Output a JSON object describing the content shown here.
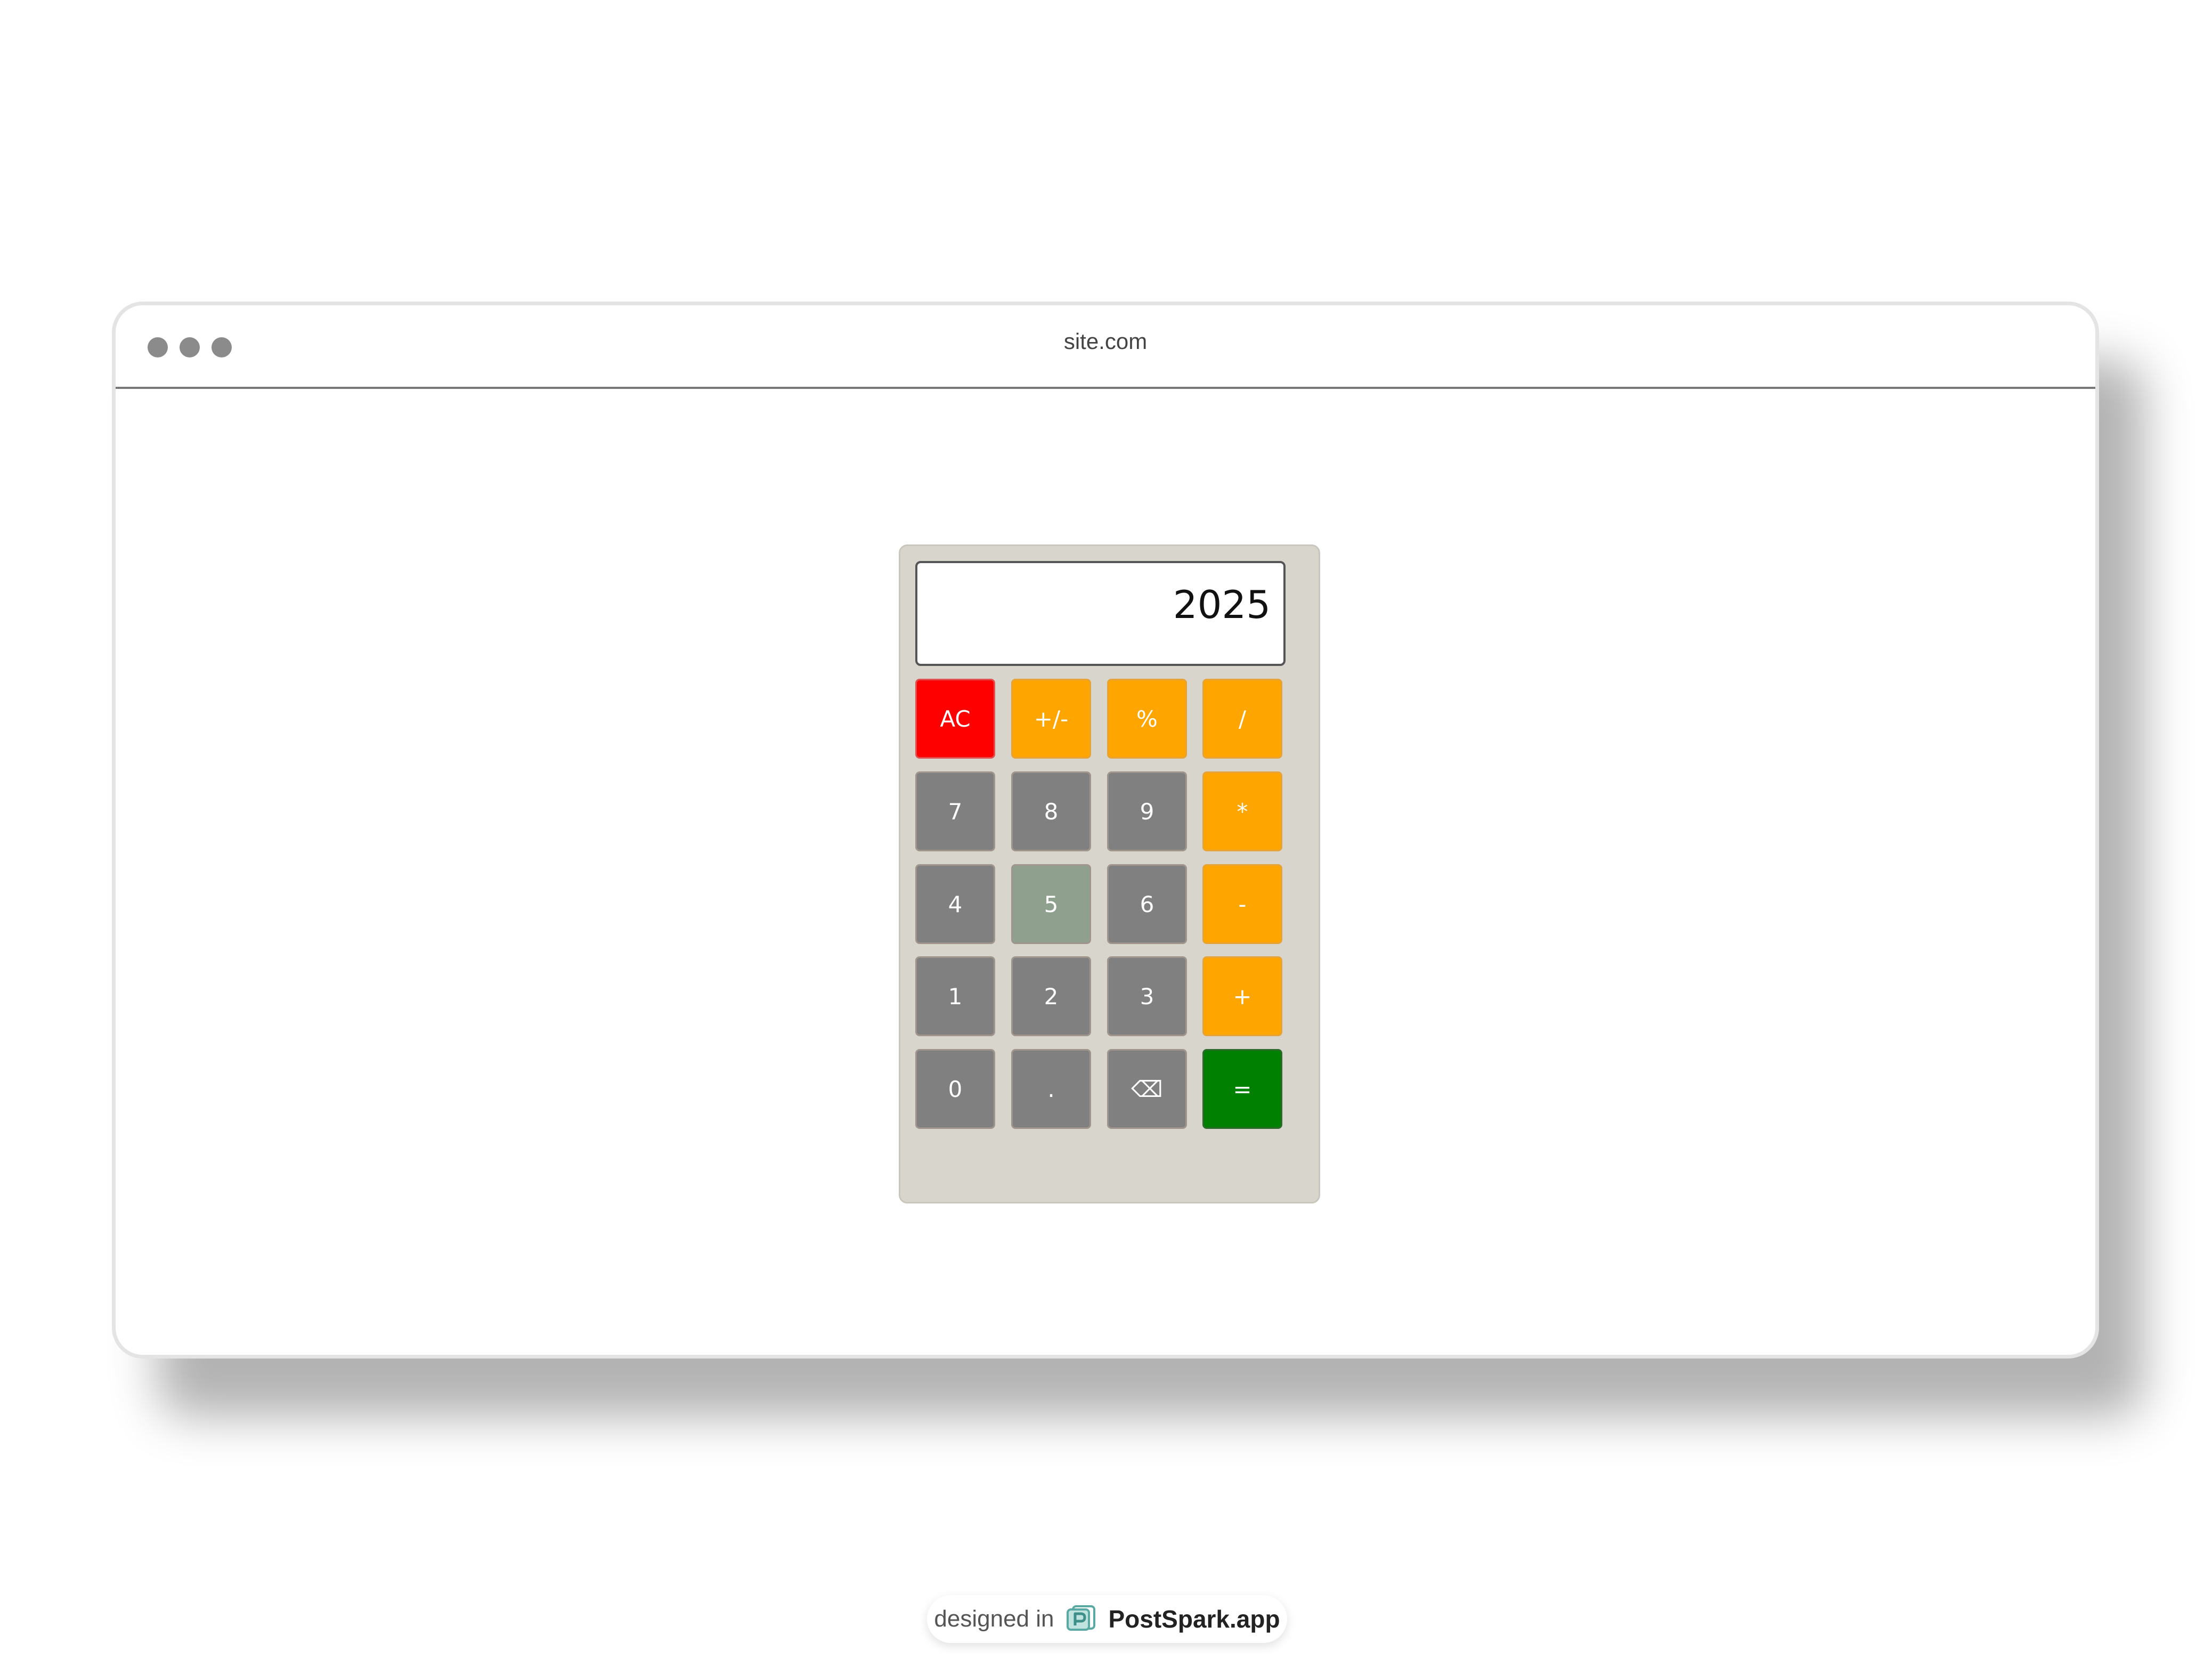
{
  "browser": {
    "url": "site.com"
  },
  "calculator": {
    "display": "2025",
    "keys": {
      "clear": "AC",
      "negate": "+/-",
      "percent": "%",
      "divide": "/",
      "seven": "7",
      "eight": "8",
      "nine": "9",
      "multiply": "*",
      "four": "4",
      "five": "5",
      "six": "6",
      "subtract": "-",
      "one": "1",
      "two": "2",
      "three": "3",
      "add": "+",
      "zero": "0",
      "decimal": ".",
      "backspace": "⌫",
      "equals": "="
    },
    "colors": {
      "body": "#d8d6cc",
      "number_key": "#808080",
      "operator_key": "#ffa500",
      "clear_key": "#ff0000",
      "equals_key": "#008000",
      "hovered_key": "#8fa08f"
    }
  },
  "footer": {
    "prefix": "designed in",
    "brand": "PostSpark.app",
    "logo_icon": "postspark-logo-icon"
  }
}
